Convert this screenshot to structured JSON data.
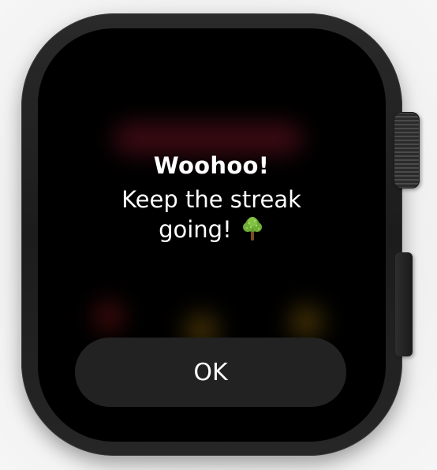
{
  "alert": {
    "title": "Woohoo!",
    "message_line1": "Keep the streak",
    "message_line2": "going!",
    "message_emoji": "tree-icon",
    "ok_label": "OK"
  },
  "colors": {
    "screen_background": "#000000",
    "button_background": "#222222",
    "text": "#ffffff"
  }
}
